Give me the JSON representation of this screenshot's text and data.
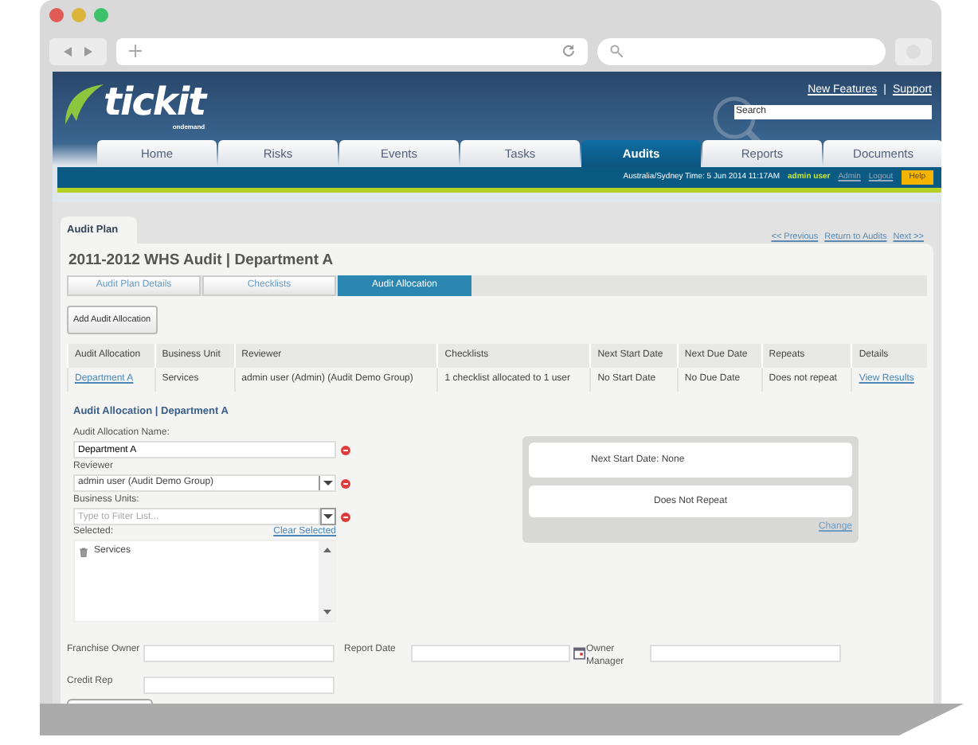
{
  "header": {
    "logo": {
      "name": "tickit",
      "tagline": "ondemand"
    },
    "links": [
      {
        "label": "New Features"
      },
      {
        "label": "Support"
      }
    ],
    "link_separator": "|",
    "search": {
      "placeholder": "Search"
    }
  },
  "nav_tabs": [
    {
      "label": "Home",
      "selected": false
    },
    {
      "label": "Risks",
      "selected": false
    },
    {
      "label": "Events",
      "selected": false
    },
    {
      "label": "Tasks",
      "selected": false
    },
    {
      "label": "Audits",
      "selected": true
    },
    {
      "label": "Reports",
      "selected": false
    },
    {
      "label": "Documents",
      "selected": false
    }
  ],
  "info_bar": {
    "time": "Australia/Sydney Time: 5 Jun 2014 11:17AM",
    "user": "admin user",
    "links": [
      "Admin",
      "Logout"
    ],
    "help": "Help"
  },
  "page_tab": "Audit Plan",
  "pager": [
    "<< Previous",
    "Return to Audits",
    "Next >>"
  ],
  "title": "2011-2012 WHS Audit | Department A",
  "sub_tabs": [
    {
      "label": "Audit Plan Details",
      "selected": false
    },
    {
      "label": "Checklists",
      "selected": false
    },
    {
      "label": "Audit Allocation",
      "selected": true
    }
  ],
  "add_button": "Add Audit Allocation",
  "table": {
    "columns": [
      "Audit Allocation",
      "Business Unit",
      "Reviewer",
      "Checklists",
      "Next Start Date",
      "Next Due Date",
      "Repeats",
      "Details"
    ],
    "rows": [
      {
        "cells": [
          "Department A",
          "Services",
          "admin user (Admin) (Audit Demo Group)",
          "1 checklist allocated to 1 user",
          "No Start Date",
          "No Due Date",
          "Does not repeat",
          "View Results"
        ]
      }
    ]
  },
  "form": {
    "section_title": "Audit Allocation | Department A",
    "name": {
      "label": "Audit Allocation Name:",
      "value": "Department A",
      "required": true
    },
    "reviewer": {
      "label": "Reviewer",
      "value": "admin user (Audit Demo Group)",
      "required": true
    },
    "business_units": {
      "label": "Business Units:",
      "placeholder": "Type to Filter List...",
      "required": true
    },
    "selected": {
      "label": "Selected:",
      "clear": "Clear Selected",
      "items": [
        "Services"
      ]
    }
  },
  "schedule": {
    "next_start": "Next Start Date: None",
    "repeat": "Does Not Repeat",
    "change": "Change"
  },
  "extra_fields": [
    {
      "label": "Franchise Owner",
      "kind": "text"
    },
    {
      "label": "Report Date",
      "kind": "date"
    },
    {
      "label": "Owner Manager",
      "kind": "text"
    },
    {
      "label": "Credit Rep",
      "kind": "text"
    }
  ]
}
